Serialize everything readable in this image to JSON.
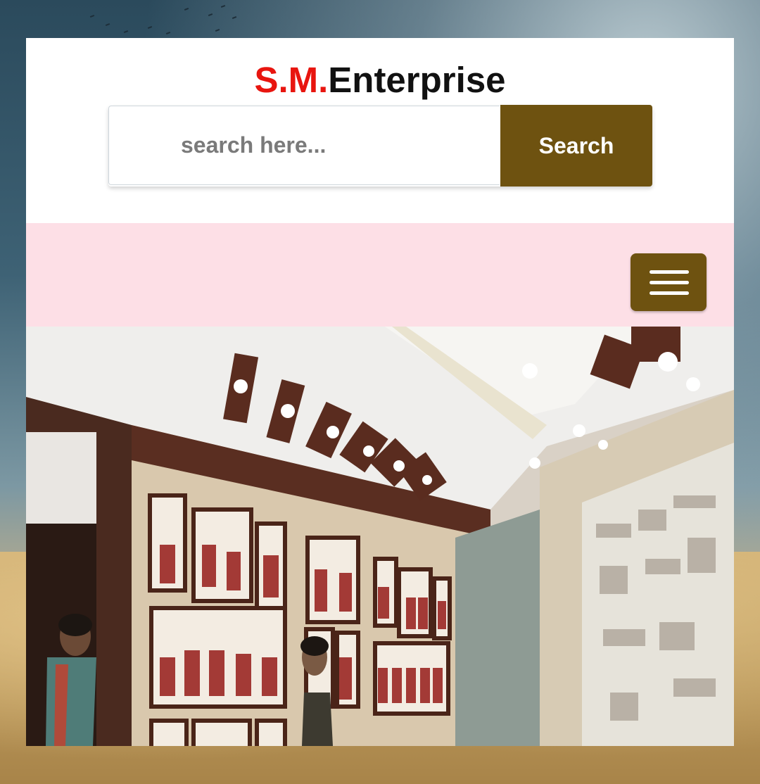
{
  "brand": {
    "part1": "S.M.",
    "part2": "Enterprise"
  },
  "search": {
    "placeholder": "search here...",
    "button_label": "Search"
  },
  "colors": {
    "brand_red": "#e8150f",
    "accent_brown": "#6e5210",
    "nav_pink": "#fddfe6"
  },
  "navbar": {
    "menu_icon": "hamburger-menu-icon"
  },
  "hero": {
    "image": "jewellery-showroom-photo"
  }
}
